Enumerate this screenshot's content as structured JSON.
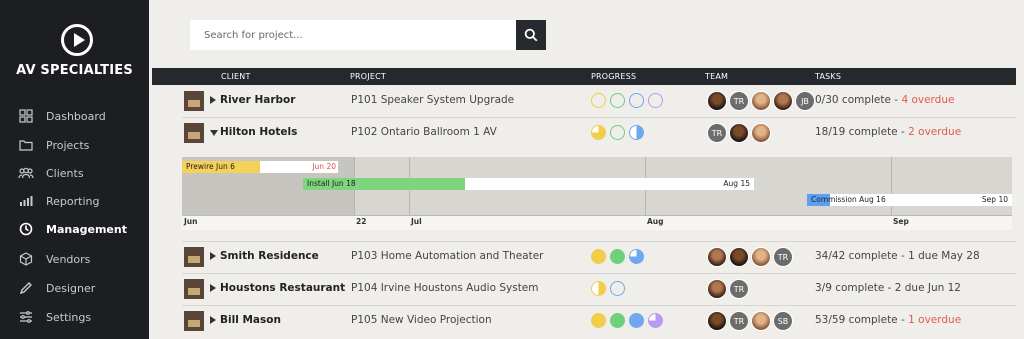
{
  "brand": {
    "name": "AV SPECIALTIES",
    "logo_icon": "play-circle-icon"
  },
  "nav": [
    {
      "label": "Dashboard",
      "icon": "dashboard-icon",
      "active": false
    },
    {
      "label": "Projects",
      "icon": "folder-icon",
      "active": false
    },
    {
      "label": "Clients",
      "icon": "users-icon",
      "active": false
    },
    {
      "label": "Reporting",
      "icon": "bar-chart-icon",
      "active": false
    },
    {
      "label": "Management",
      "icon": "clock-icon",
      "active": true
    },
    {
      "label": "Vendors",
      "icon": "box-icon",
      "active": false
    },
    {
      "label": "Designer",
      "icon": "pencil-icon",
      "active": false
    },
    {
      "label": "Settings",
      "icon": "sliders-icon",
      "active": false
    }
  ],
  "search": {
    "placeholder": "Search for project...",
    "button_icon": "search-icon"
  },
  "columns": {
    "client": "CLIENT",
    "project": "PROJECT",
    "progress": "PROGRESS",
    "team": "TEAM",
    "tasks": "TASKS"
  },
  "rows": [
    {
      "client": "River Harbor",
      "expanded": false,
      "project": "P101 Speaker System Upgrade",
      "progress": [
        {
          "color": "#f2cd4a",
          "state": "empty"
        },
        {
          "color": "#6fd07c",
          "state": "empty"
        },
        {
          "color": "#6fa8f0",
          "state": "empty"
        },
        {
          "color": "#b79af2",
          "state": "empty"
        }
      ],
      "team": [
        {
          "type": "photo"
        },
        {
          "type": "initials",
          "text": "TR"
        },
        {
          "type": "photo"
        },
        {
          "type": "photo"
        },
        {
          "type": "initials",
          "text": "JB"
        }
      ],
      "tasks": {
        "complete": "0/30 complete",
        "sep": " - ",
        "status": "4 overdue",
        "status_kind": "overdue"
      }
    },
    {
      "client": "Hilton Hotels",
      "expanded": true,
      "project": "P102 Ontario Ballroom 1 AV",
      "progress": [
        {
          "color": "#f2cd4a",
          "state": "partial"
        },
        {
          "color": "#6fd07c",
          "state": "empty"
        },
        {
          "color": "#6fa8f0",
          "state": "half"
        }
      ],
      "team": [
        {
          "type": "initials",
          "text": "TR"
        },
        {
          "type": "photo"
        },
        {
          "type": "photo"
        }
      ],
      "tasks": {
        "complete": "18/19 complete",
        "sep": " - ",
        "status": "2 overdue",
        "status_kind": "overdue"
      }
    },
    {
      "client": "Smith Residence",
      "expanded": false,
      "project": "P103 Home Automation and Theater",
      "progress": [
        {
          "color": "#f2cd4a",
          "state": "full"
        },
        {
          "color": "#6fd07c",
          "state": "full"
        },
        {
          "color": "#6fa8f0",
          "state": "partial"
        }
      ],
      "team": [
        {
          "type": "photo"
        },
        {
          "type": "photo"
        },
        {
          "type": "photo"
        },
        {
          "type": "initials",
          "text": "TR"
        }
      ],
      "tasks": {
        "complete": "34/42 complete",
        "sep": " - ",
        "status": "1 due May 28",
        "status_kind": "due"
      }
    },
    {
      "client": "Houstons Restaurant",
      "expanded": false,
      "project": "P104 Irvine Houstons Audio System",
      "progress": [
        {
          "color": "#f2cd4a",
          "state": "half"
        },
        {
          "color": "#6fa8f0",
          "state": "empty"
        }
      ],
      "team": [
        {
          "type": "photo"
        },
        {
          "type": "initials",
          "text": "TR"
        }
      ],
      "tasks": {
        "complete": "3/9 complete",
        "sep": " - ",
        "status": "2 due Jun 12",
        "status_kind": "due"
      }
    },
    {
      "client": "Bill Mason",
      "expanded": false,
      "project": "P105 New Video Projection",
      "progress": [
        {
          "color": "#f2cd4a",
          "state": "full"
        },
        {
          "color": "#6fd07c",
          "state": "full"
        },
        {
          "color": "#6fa8f0",
          "state": "full"
        },
        {
          "color": "#b79af2",
          "state": "partial"
        }
      ],
      "team": [
        {
          "type": "photo"
        },
        {
          "type": "initials",
          "text": "TR"
        },
        {
          "type": "photo"
        },
        {
          "type": "initials",
          "text": "SB"
        }
      ],
      "tasks": {
        "complete": "53/59 complete",
        "sep": " - ",
        "status": "1 overdue",
        "status_kind": "overdue"
      }
    }
  ],
  "gantt": {
    "ticks": [
      "Jun",
      "22",
      "Jul",
      "Aug",
      "Sep"
    ],
    "bars": [
      {
        "label": "Prewire Jun 6",
        "end_label": "Jun 20",
        "color": "#f5d257",
        "end_color": "red",
        "progress": 0.5
      },
      {
        "label": "Install Jun 18",
        "end_label": "Aug 15",
        "color": "#7fd47e",
        "end_color": "dark",
        "progress": 0.36
      },
      {
        "label": "Commission Aug 16",
        "end_label": "Sep 10",
        "color": "#5c9ef2",
        "end_color": "dark",
        "progress": 0.11
      }
    ]
  }
}
